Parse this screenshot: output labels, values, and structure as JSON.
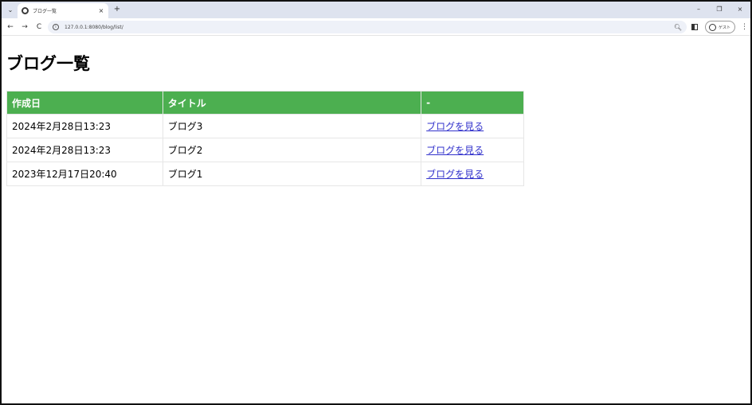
{
  "browser": {
    "tab": {
      "title": "ブログ一覧",
      "close_glyph": "×",
      "favicon_icon": "globe-icon"
    },
    "new_tab_glyph": "+",
    "window_controls": {
      "minimize": "–",
      "restore": "❐",
      "close": "×"
    },
    "nav": {
      "back": "←",
      "forward": "→",
      "reload": "C"
    },
    "address": {
      "url": "127.0.0.1:8080/blog/list/"
    },
    "profile": {
      "label": "ゲスト"
    }
  },
  "page": {
    "title": "ブログ一覧",
    "table": {
      "headers": [
        "作成日",
        "タイトル",
        "-"
      ],
      "rows": [
        {
          "date": "2024年2月28日13:23",
          "title": "ブログ3",
          "link": "ブログを見る"
        },
        {
          "date": "2024年2月28日13:23",
          "title": "ブログ2",
          "link": "ブログを見る"
        },
        {
          "date": "2023年12月17日20:40",
          "title": "ブログ1",
          "link": "ブログを見る"
        }
      ]
    }
  },
  "colors": {
    "header_bg": "#4caf50",
    "header_text": "#ffffff",
    "link": "#3333cc",
    "tabstrip_bg": "#dee3ef",
    "omnibox_bg": "#eef1f8"
  }
}
